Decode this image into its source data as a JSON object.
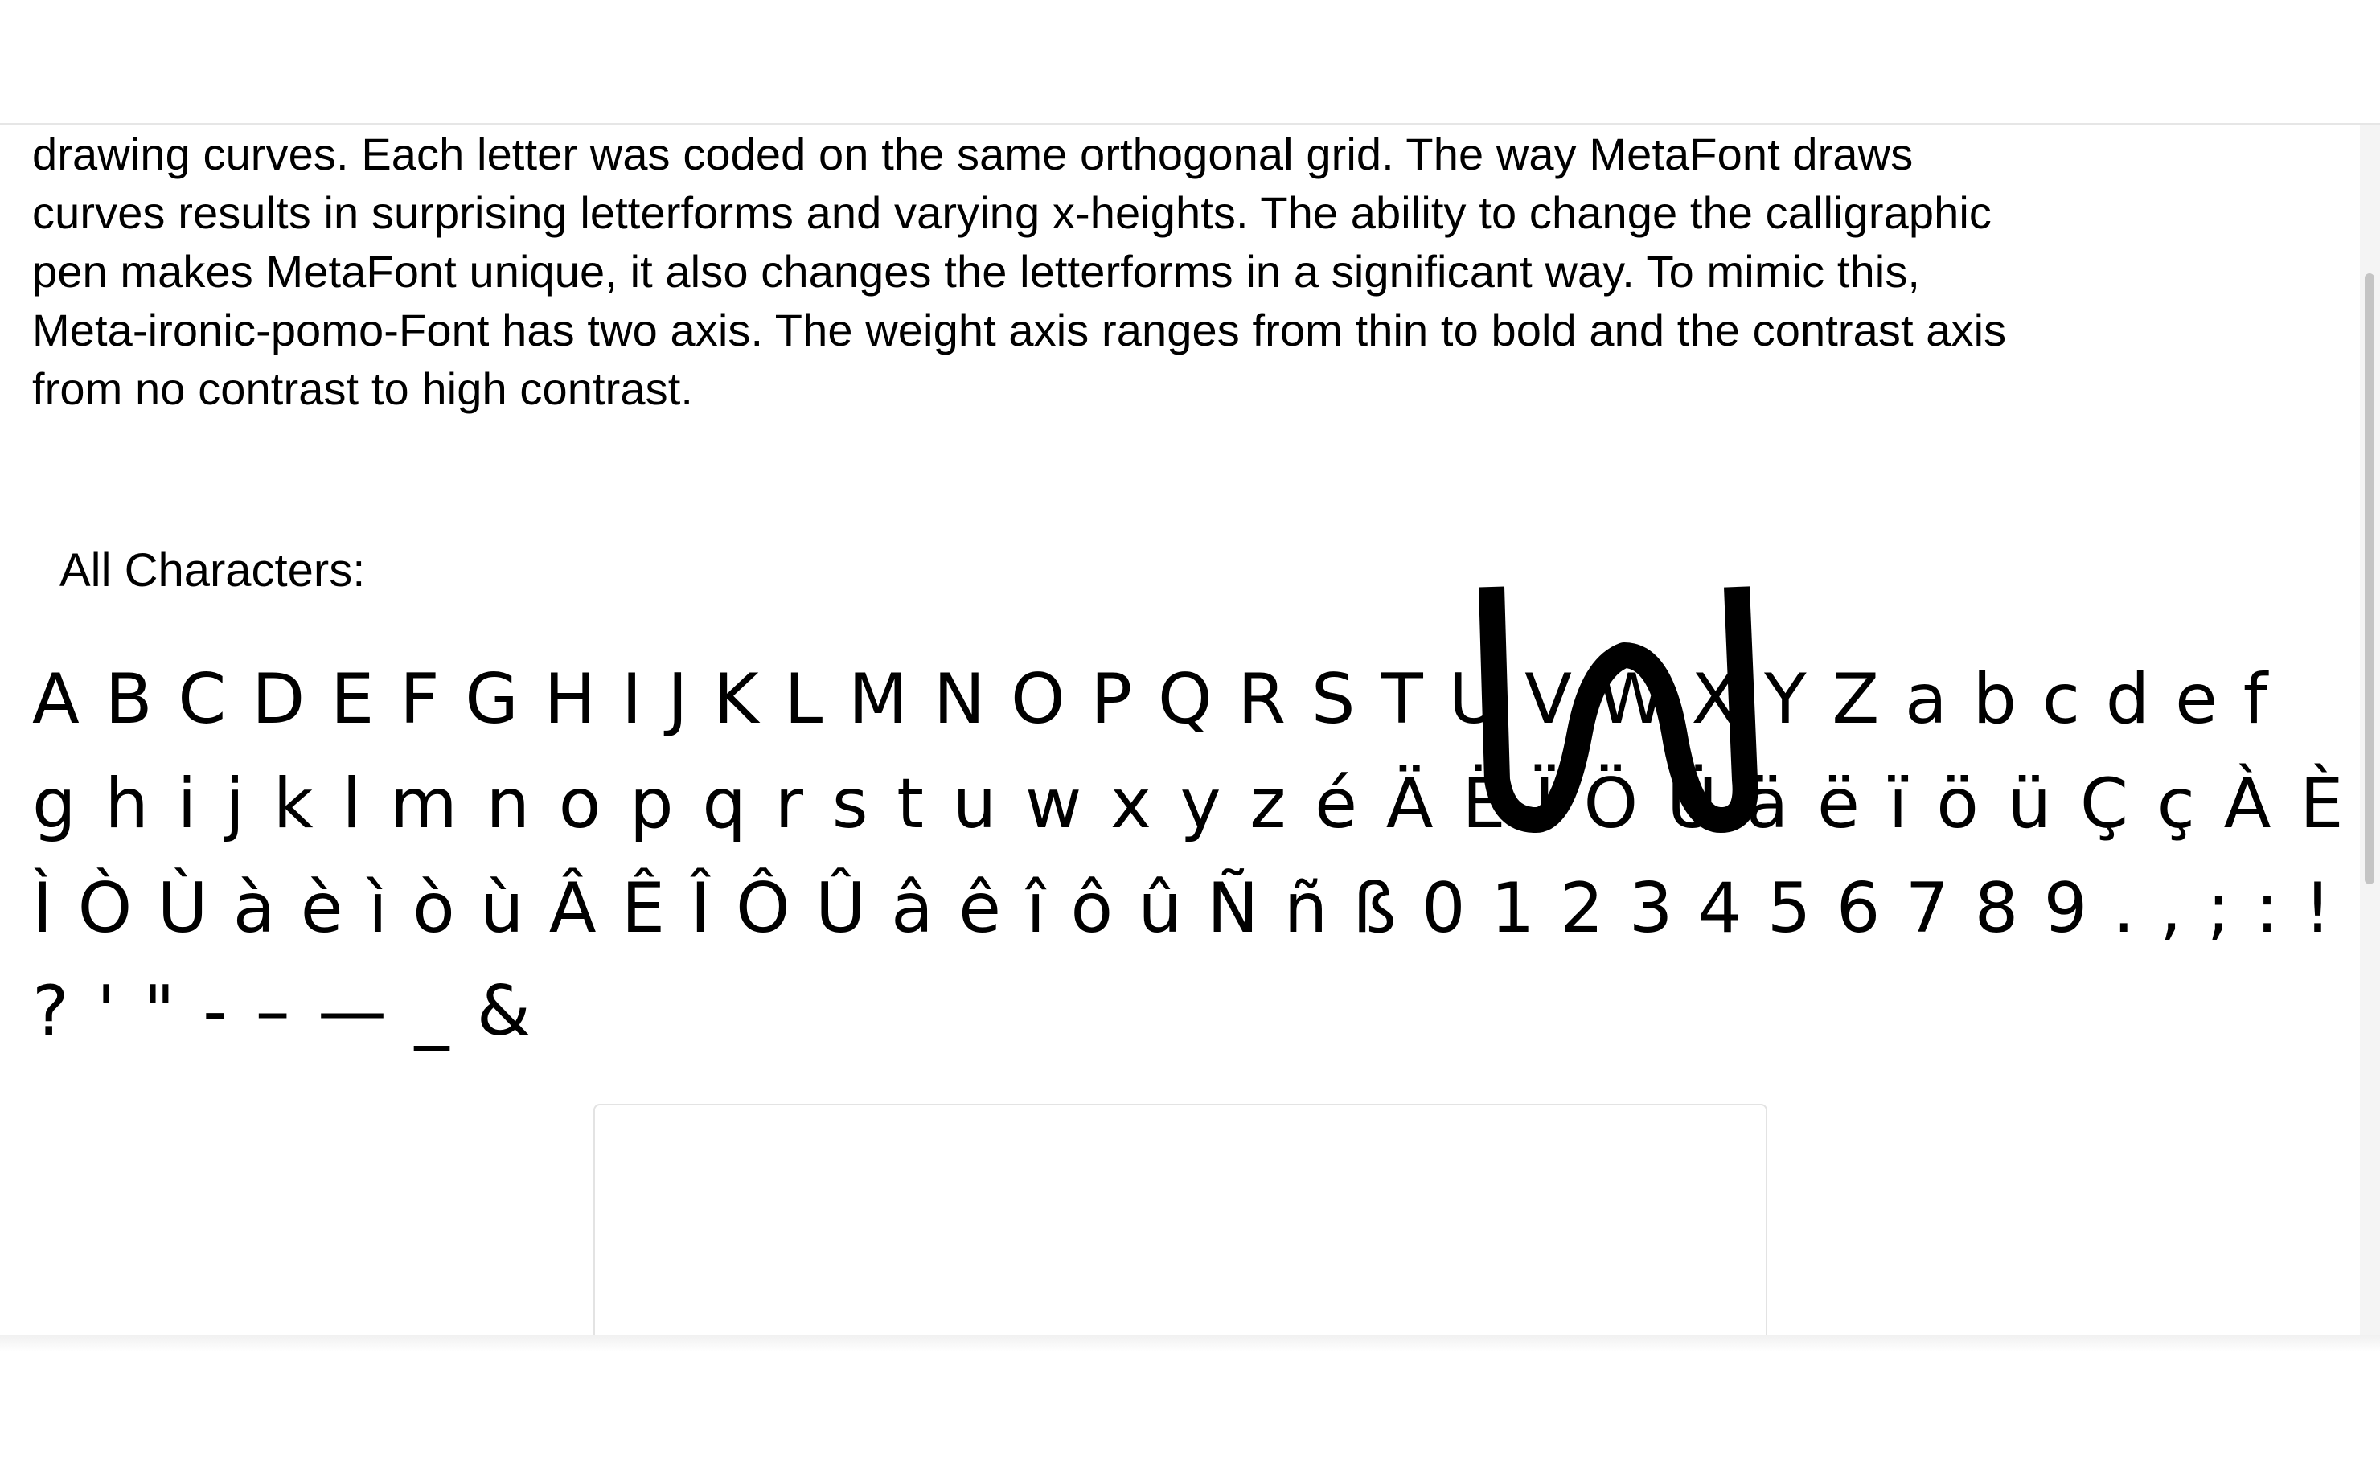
{
  "intro_lines": [
    "drawing curves. Each letter was coded on the same orthogonal grid. The way MetaFont draws",
    "curves results in surprising letterforms and varying x-heights. The ability to change the calligraphic",
    "pen makes MetaFont unique, it also changes the letterforms in a significant way. To mimic this,",
    "Meta-ironic-pomo-Font has two axis. The weight axis ranges from thin to bold and the contrast axis",
    "from no contrast to high contrast."
  ],
  "section_label": "All Characters:",
  "character_rows": [
    [
      "A",
      "B",
      "C",
      "D",
      "E",
      "F",
      "G",
      "H",
      "I",
      "J",
      "K",
      "L",
      "M",
      "N",
      "O",
      "P",
      "Q",
      "R",
      "S",
      "T",
      "U",
      "V",
      "W",
      "X",
      "Y",
      "Z",
      "a",
      "b",
      "c",
      "d",
      "e",
      "f"
    ],
    [
      "g",
      "h",
      "i",
      "j",
      "k",
      "l",
      "m",
      "n",
      "o",
      "p",
      "q",
      "r",
      "s",
      "t",
      "u",
      "w",
      "x",
      "y",
      "z",
      "é",
      "Ä",
      "Ë",
      "Ï",
      "Ö",
      "Ü",
      "ä",
      "ë",
      "ï",
      "ö",
      "ü",
      "Ç",
      "ç",
      "À",
      "È"
    ],
    [
      "Ì",
      "Ò",
      "Ù",
      "à",
      "è",
      "ì",
      "ò",
      "ù",
      "Â",
      "Ê",
      "Î",
      "Ô",
      "Û",
      "â",
      "ê",
      "î",
      "ô",
      "û",
      "Ñ",
      "ñ",
      "ß",
      "0",
      "1",
      "2",
      "3",
      "4",
      "5",
      "6",
      "7",
      "8",
      "9",
      ".",
      ",",
      ";",
      ":",
      "!"
    ],
    [
      "?",
      "'",
      "\"",
      "-",
      "–",
      "—",
      "_",
      "&"
    ]
  ],
  "icons": {
    "enlarged_glyph": "w-glyph-icon"
  }
}
